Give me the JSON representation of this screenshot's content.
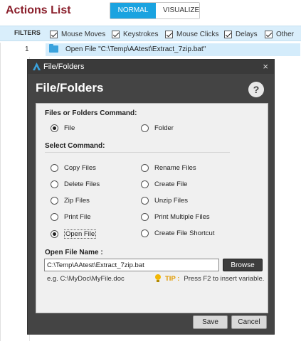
{
  "header": {
    "title": "Actions List",
    "normal_label": "NORMAL",
    "visualize_label": "VISUALIZE"
  },
  "filters": {
    "label": "FILTERS",
    "items": [
      "Mouse Moves",
      "Keystrokes",
      "Mouse Clicks",
      "Delays",
      "Other"
    ]
  },
  "list": {
    "row_number": "1",
    "row_text": "Open File \"C:\\Temp\\AAtest\\Extract_7zip.bat\""
  },
  "dialog": {
    "title": "File/Folders",
    "heading": "File/Folders",
    "help_label": "?",
    "close_label": "×",
    "files_or_folders_label": "Files or Folders Command:",
    "type_options": [
      "File",
      "Folder"
    ],
    "selected_type": "File",
    "select_command_label": "Select Command:",
    "commands_left": [
      "Copy Files",
      "Delete Files",
      "Zip Files",
      "Print File",
      "Open File"
    ],
    "commands_right": [
      "Rename Files",
      "Create File",
      "Unzip Files",
      "Print Multiple Files",
      "Create File Shortcut"
    ],
    "selected_command": "Open File",
    "file_name_label": "Open File Name :",
    "file_name_value": "C:\\Temp\\AAtest\\Extract_7zip.bat",
    "browse_label": "Browse",
    "example_text": "e.g. C:\\MyDoc\\MyFile.doc",
    "tip_label": "TIP :",
    "tip_text": "Press F2 to insert variable.",
    "save_label": "Save",
    "cancel_label": "Cancel"
  },
  "colors": {
    "title": "#8a1f2b",
    "accent": "#1aa3e0",
    "filter_bar": "#d9eefb",
    "dialog_bg": "#444444"
  }
}
